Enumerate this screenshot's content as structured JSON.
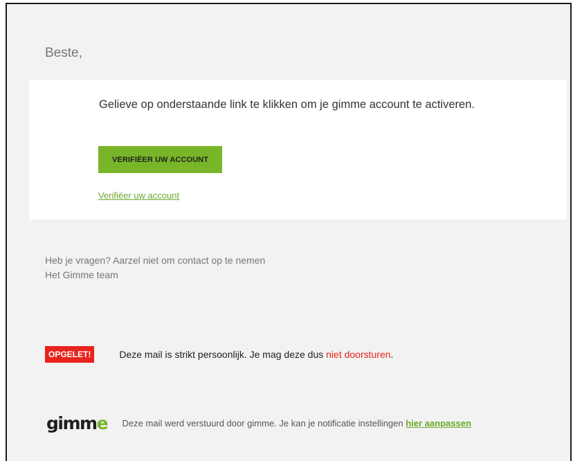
{
  "email": {
    "greeting": "Beste,",
    "card": {
      "message": "Gelieve op onderstaande link te klikken om je gimme account te activeren.",
      "button_label": "VERIFIËER UW ACCOUNT",
      "link_label": "Verifiëer uw account"
    },
    "closing": {
      "line1": "Heb je vragen? Aarzel niet om contact op te nemen",
      "line2": "Het Gimme team"
    },
    "warning": {
      "badge": "OPGELET!",
      "text": "Deze mail is strikt persoonlijk. Je mag deze dus ",
      "emphasis": "niet doorsturen",
      "end": "."
    },
    "footer": {
      "logo_main": "gimm",
      "logo_accent": "e",
      "text": "Deze mail werd verstuurd door gimme. Je kan je notificatie instellingen ",
      "link_label": "hier aanpassen"
    }
  },
  "colors": {
    "accent_green": "#78b528",
    "warning_red": "#e8231b",
    "background": "#f2f2f2"
  },
  "icons": {
    "logo": "gimme-logo"
  }
}
